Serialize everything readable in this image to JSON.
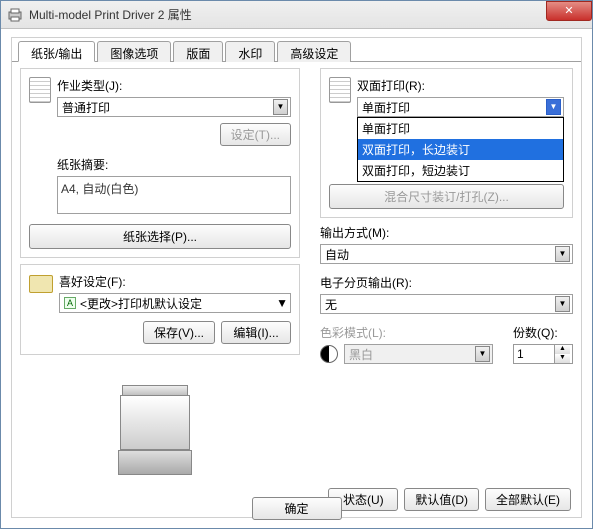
{
  "window": {
    "title": "Multi-model Print Driver 2 属性"
  },
  "tabs": [
    "纸张/输出",
    "图像选项",
    "版面",
    "水印",
    "高级设定"
  ],
  "activeTab": 0,
  "left": {
    "jobType": {
      "label": "作业类型(J):",
      "value": "普通打印"
    },
    "settingsBtn": "设定(T)...",
    "paperSummary": {
      "label": "纸张摘要:",
      "value": "A4, 自动(白色)"
    },
    "paperSelectBtn": "纸张选择(P)...",
    "favorites": {
      "label": "喜好设定(F):",
      "value": "<更改>打印机默认设定",
      "saveBtn": "保存(V)...",
      "editBtn": "编辑(I)..."
    }
  },
  "right": {
    "duplex": {
      "label": "双面打印(R):",
      "value": "单面打印",
      "options": [
        "单面打印",
        "双面打印，长边装订",
        "双面打印，短边装订"
      ],
      "highlightedIndex": 1
    },
    "mixedBtn": "混合尺寸装订/打孔(Z)...",
    "outputMethod": {
      "label": "输出方式(M):",
      "value": "自动"
    },
    "collate": {
      "label": "电子分页输出(R):",
      "value": "无"
    },
    "colorMode": {
      "label": "色彩模式(L):",
      "value": "黑白"
    },
    "copies": {
      "label": "份数(Q):",
      "value": "1"
    }
  },
  "bottomButtons": {
    "status": "状态(U)",
    "defaults": "默认值(D)",
    "allDefaults": "全部默认(E)"
  },
  "okBtn": "确定"
}
